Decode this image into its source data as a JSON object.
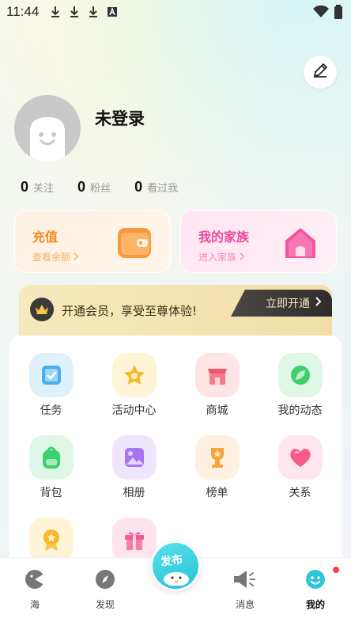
{
  "status_bar": {
    "time": "11:44",
    "icons": [
      "download-icon",
      "download-icon",
      "download-icon",
      "notification-a-icon",
      "wifi-icon",
      "battery-icon"
    ]
  },
  "profile": {
    "username": "未登录",
    "stats": [
      {
        "num": "0",
        "label": "关注"
      },
      {
        "num": "0",
        "label": "粉丝"
      },
      {
        "num": "0",
        "label": "看过我"
      }
    ]
  },
  "cards": {
    "recharge": {
      "title": "充值",
      "sub": "查看余额"
    },
    "family": {
      "title": "我的家族",
      "sub": "进入家族"
    }
  },
  "vip": {
    "text": "开通会员，享受至尊体验!",
    "button": "立即开通"
  },
  "grid": [
    {
      "label": "任务",
      "icon": "task-icon",
      "bg": "#dff1fb",
      "fg": "#3fa9f0"
    },
    {
      "label": "活动中心",
      "icon": "star-icon",
      "bg": "#fff4d6",
      "fg": "#f7b72b"
    },
    {
      "label": "商城",
      "icon": "shop-icon",
      "bg": "#ffe4e6",
      "fg": "#f3566b"
    },
    {
      "label": "我的动态",
      "icon": "leaf-icon",
      "bg": "#def7e6",
      "fg": "#3ecf6e"
    },
    {
      "label": "背包",
      "icon": "backpack-icon",
      "bg": "#def7e6",
      "fg": "#3ecf6e"
    },
    {
      "label": "相册",
      "icon": "album-icon",
      "bg": "#efe6fd",
      "fg": "#a874f4"
    },
    {
      "label": "榜单",
      "icon": "trophy-icon",
      "bg": "#fff0df",
      "fg": "#f7a23b"
    },
    {
      "label": "关系",
      "icon": "heart-icon",
      "bg": "#ffe6ee",
      "fg": "#f55b86"
    },
    {
      "label": "",
      "icon": "medal-icon",
      "bg": "#fff4d6",
      "fg": "#f7b72b"
    },
    {
      "label": "",
      "icon": "gift-icon",
      "bg": "#ffe4ee",
      "fg": "#f05b93"
    }
  ],
  "tabs": [
    {
      "label": "海",
      "icon": "ocean-icon"
    },
    {
      "label": "发现",
      "icon": "discover-icon"
    },
    {
      "label": "消息",
      "icon": "message-icon"
    },
    {
      "label": "我的",
      "icon": "me-icon"
    }
  ],
  "publish": {
    "label": "发布"
  }
}
